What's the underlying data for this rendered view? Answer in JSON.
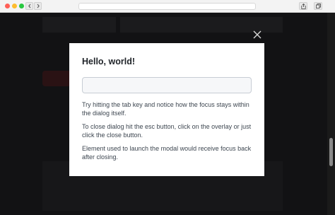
{
  "modal": {
    "title": "Hello, world!",
    "input_value": "",
    "paragraphs": [
      "Try hitting the tab key and notice how the focus stays within the dialog itself.",
      "To close dialog hit the esc button, click on the overlay or just click the close button.",
      "Element used to launch the modal would receive focus back after closing."
    ]
  },
  "icons": {
    "close": "close-icon",
    "back": "chevron-left-icon",
    "forward": "chevron-right-icon",
    "share": "share-icon",
    "tabs": "tabs-icon"
  },
  "colors": {
    "overlay": "#121214",
    "modal_bg": "#ffffff",
    "text": "#3d4650",
    "title": "#1f2328"
  }
}
